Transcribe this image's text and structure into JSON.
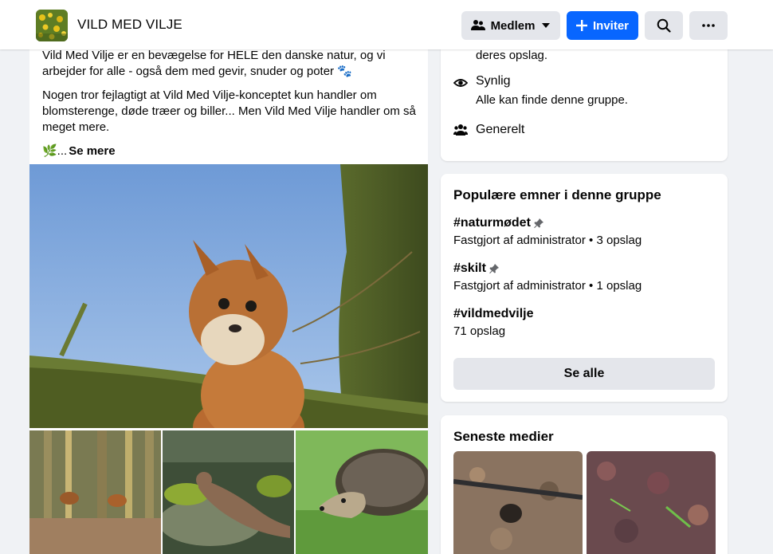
{
  "header": {
    "group_name": "VILD MED VILJE",
    "member_label": "Medlem",
    "invite_label": "Inviter"
  },
  "post": {
    "paragraph1": "Vild Med Vilje er en bevægelse for HELE den danske natur, og vi arbejder for alle - også dem med gevir, snuder og poter 🐾",
    "paragraph2": "Nogen tror fejlagtigt at Vild Med Vilje-konceptet kun handler om blomsterenge, døde træer og biller... Men Vild Med Vilje handler om så meget mere.",
    "see_more_prefix": "🌿...",
    "see_more_label": "Se mere"
  },
  "about": {
    "partial_text": "deres opslag.",
    "visible_title": "Synlig",
    "visible_desc": "Alle kan finde denne gruppe.",
    "general_title": "Generelt"
  },
  "topics": {
    "title": "Populære emner i denne gruppe",
    "items": [
      {
        "tag": "#naturmødet",
        "meta": "Fastgjort af administrator • 3 opslag",
        "pinned": true
      },
      {
        "tag": "#skilt",
        "meta": "Fastgjort af administrator • 1 opslag",
        "pinned": true
      },
      {
        "tag": "#vildmedvilje",
        "meta": "71 opslag",
        "pinned": false
      }
    ],
    "see_all_label": "Se alle"
  },
  "media": {
    "title": "Seneste medier"
  },
  "colors": {
    "accent": "#0866ff",
    "background": "#f0f2f5",
    "button_grey": "#e4e6eb"
  }
}
